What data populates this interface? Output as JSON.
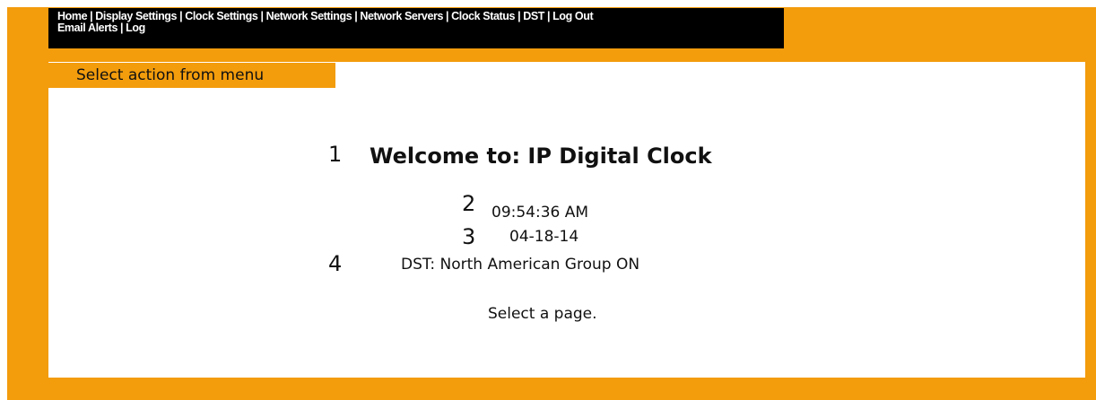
{
  "nav": {
    "row1": [
      "Home",
      "Display Settings",
      "Clock Settings",
      "Network Settings",
      "Network Servers",
      "Clock Status",
      "DST",
      "Log Out"
    ],
    "row2": [
      "Email Alerts",
      "Log"
    ]
  },
  "action_label": "Select action from menu",
  "main": {
    "welcome": "Welcome to: IP Digital Clock",
    "time": "09:54:36 AM",
    "date": "04-18-14",
    "dst": "DST: North American Group ON",
    "prompt": "Select a page."
  },
  "annotations": {
    "n1": "1",
    "n2": "2",
    "n3": "3",
    "n4": "4"
  },
  "colors": {
    "frame": "#F39C0C",
    "nav_bg": "#000000",
    "content_bg": "#FFFFFF"
  }
}
